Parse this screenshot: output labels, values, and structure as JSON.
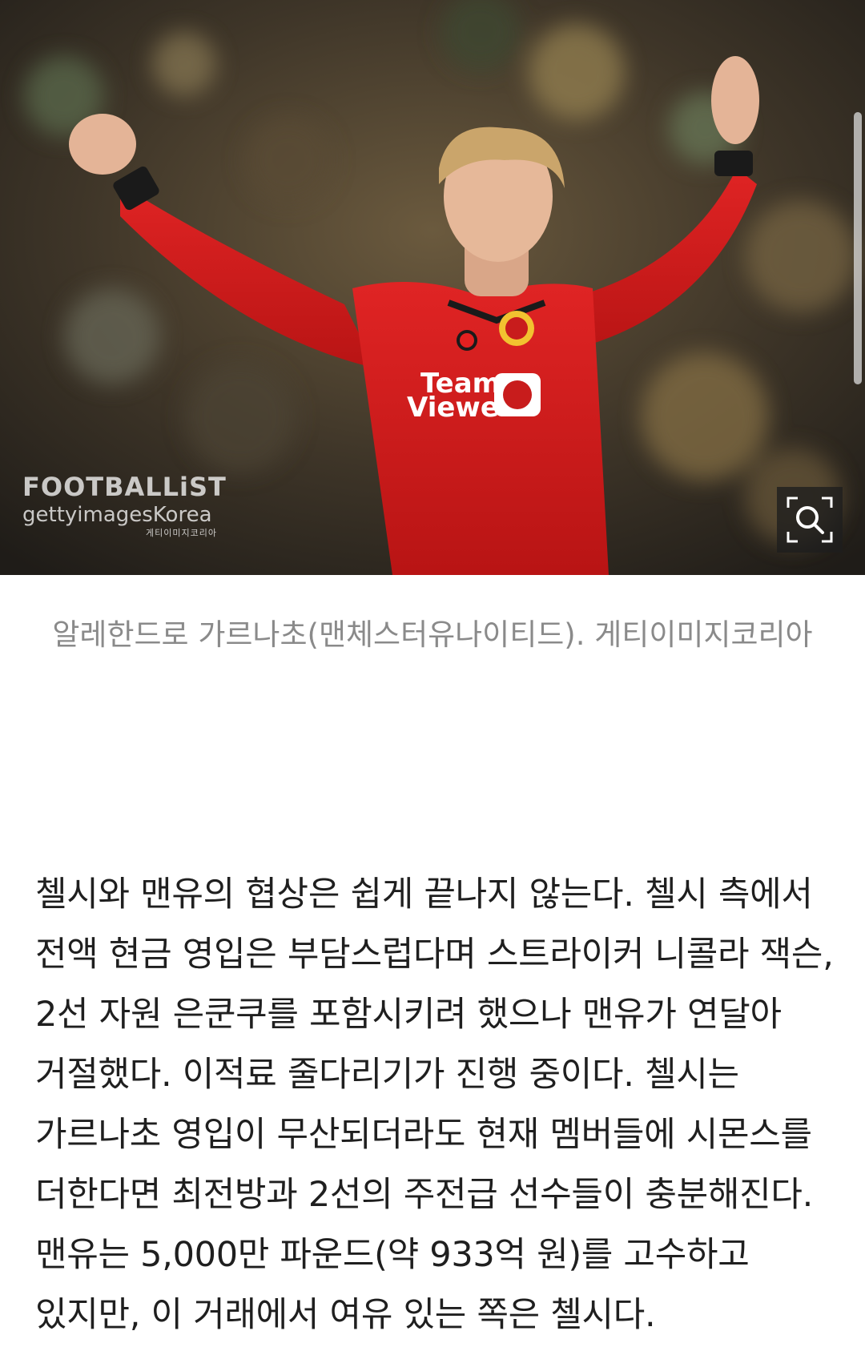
{
  "photo": {
    "alt_subject": "player",
    "watermark_brand": "FOOTBALLiST",
    "watermark_agency": "gettyimagesKorea",
    "watermark_small": "게티이미지코리아",
    "shirt_sponsor_line1": "Team",
    "shirt_sponsor_line2": "Viewer",
    "zoom_icon": "zoom-search-icon"
  },
  "caption": "알레한드로 가르나초(맨체스터유나이티드). 게티이미지코리아",
  "article": {
    "paragraph": "첼시와 맨유의 협상은 쉽게 끝나지 않는다. 첼시 측에서 전액 현금 영입은 부담스럽다며 스트라이커 니콜라 잭슨, 2선 자원 은쿤쿠를 포함시키려 했으나 맨유가 연달아 거절했다. 이적료 줄다리기가 진행 중이다. 첼시는 가르나초 영입이 무산되더라도 현재 멤버들에 시몬스를 더한다면 최전방과 2선의 주전급 선수들이 충분해진다. 맨유는 5,000만 파운드(약 933억 원)를 고수하고 있지만, 이 거래에서 여유 있는 쪽은 첼시다."
  },
  "colors": {
    "shirt_red": "#d41c1c",
    "caption_gray": "#8a8a8a",
    "body_text": "#1f1f1f"
  }
}
